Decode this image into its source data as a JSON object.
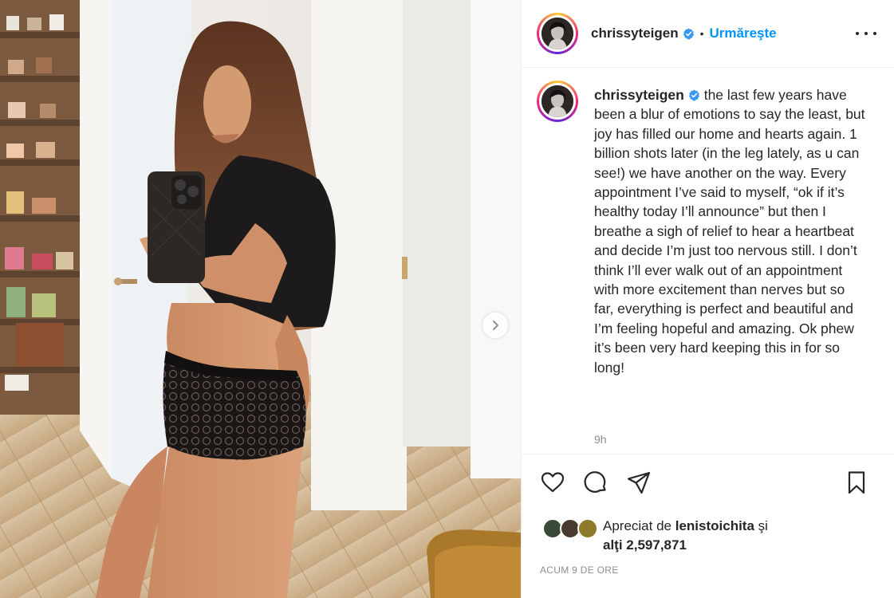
{
  "post": {
    "username": "chrissyteigen",
    "follow_label": "Urmăreşte",
    "dot": "•",
    "caption": "the last few years have been a blur of emotions to say the least, but joy has filled our home and hearts again. 1 billion shots later (in the leg lately, as u can see!) we have another on the way. Every appointment I’ve said to myself, “ok if it’s healthy today I’ll announce” but then I breathe a sigh of relief to hear a heartbeat and decide I’m just too nervous still. I don’t think I’ll ever walk out of an appointment with more excitement than nerves but so far, everything is perfect and beautiful and I’m feeling hopeful and amazing. Ok phew it’s been very hard keeping this in for so long!",
    "time_ago": "9h",
    "likes_prefix": "Apreciat de",
    "likes_user": "lenistoichita",
    "likes_and": "şi",
    "likes_others": "alţi 2,597,871",
    "posted_ago": "ACUM 9 DE ORE"
  },
  "icons": {
    "verified": "verified-badge-icon",
    "more": "more-options-icon",
    "like": "heart-icon",
    "comment": "comment-bubble-icon",
    "share": "paper-plane-icon",
    "save": "bookmark-icon",
    "next": "chevron-right-icon"
  },
  "colors": {
    "accent": "#0095f6",
    "verified": "#3897f0",
    "muted": "#8e8e8e",
    "text": "#262626"
  }
}
